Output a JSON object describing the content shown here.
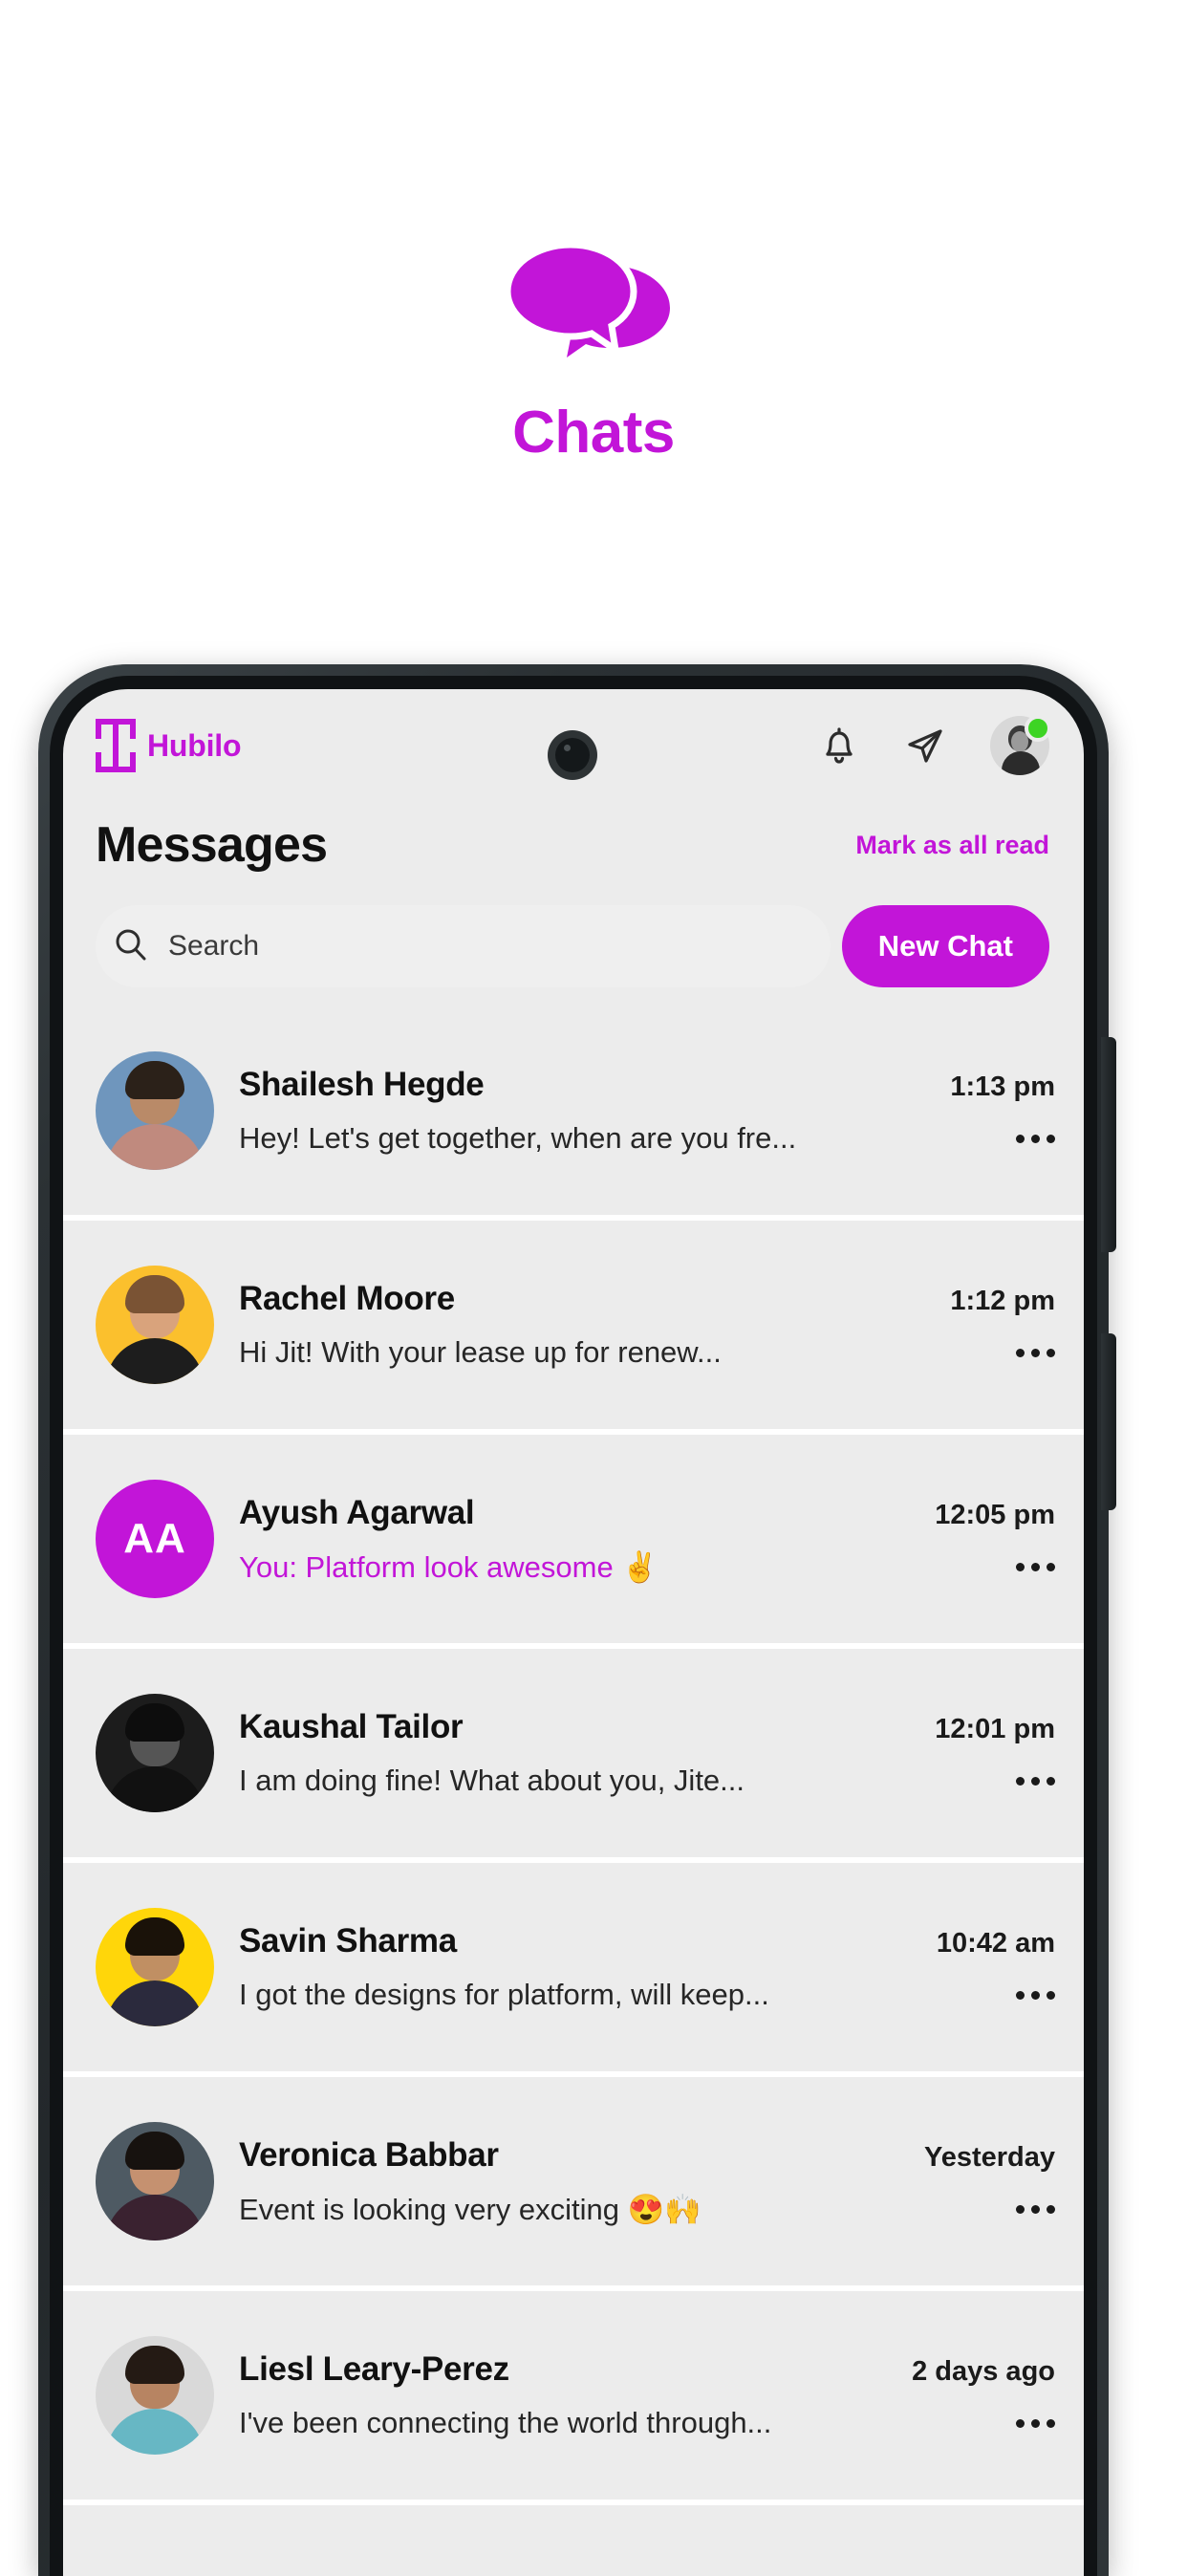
{
  "hero": {
    "title": "Chats",
    "icon": "chat-bubbles-icon",
    "accent_color": "#C215D8"
  },
  "phone": {
    "screen_bg": "#ECECEC",
    "frame_color": "#23282b"
  },
  "appbar": {
    "brand_name": "Hubilo",
    "brand_mark": "hubilo-logo-icon",
    "actions": [
      {
        "name": "notifications-icon",
        "label": "Notifications"
      },
      {
        "name": "send-message-icon",
        "label": "Send"
      },
      {
        "name": "profile-avatar",
        "label": "Profile",
        "status": "online",
        "status_color": "#3DD424"
      }
    ]
  },
  "header": {
    "title": "Messages",
    "mark_all_read": "Mark as all read"
  },
  "search": {
    "placeholder": "Search",
    "value": "",
    "icon": "search-icon"
  },
  "new_chat": {
    "label": "New Chat",
    "color": "#C215D8"
  },
  "chats": [
    {
      "name": "Shailesh Hegde",
      "time": "1:13 pm",
      "preview": "Hey! Let's get together, when are you fre...",
      "own_message": false,
      "avatar_type": "photo",
      "avatar_bg": "#6f96bd",
      "skin": "#b98a68",
      "hair": "#2b2119",
      "shirt": "#c08a7e"
    },
    {
      "name": "Rachel Moore",
      "time": "1:12 pm",
      "preview": "Hi Jit! With your lease up for renew...",
      "own_message": false,
      "avatar_type": "photo",
      "avatar_bg": "#FBC02D",
      "skin": "#d9a37c",
      "hair": "#7a5334",
      "shirt": "#1d1d1d"
    },
    {
      "name": "Ayush Agarwal",
      "time": "12:05 pm",
      "preview": "You: Platform look awesome ✌️",
      "own_message": true,
      "avatar_type": "initials",
      "initials": "AA",
      "avatar_bg": "#C215D8"
    },
    {
      "name": "Kaushal Tailor",
      "time": "12:01 pm",
      "preview": "I am doing fine! What about you, Jite...",
      "own_message": false,
      "avatar_type": "photo",
      "avatar_bg": "#1c1c1c",
      "skin": "#555555",
      "hair": "#0d0d0d",
      "shirt": "#111111"
    },
    {
      "name": "Savin Sharma",
      "time": "10:42 am",
      "preview": "I got the designs for platform, will keep...",
      "own_message": false,
      "avatar_type": "photo",
      "avatar_bg": "#FFD60A",
      "skin": "#c08f63",
      "hair": "#1a1209",
      "shirt": "#2b2a3d"
    },
    {
      "name": "Veronica Babbar",
      "time": "Yesterday",
      "preview": "Event is looking very exciting 😍🙌",
      "own_message": false,
      "avatar_type": "photo",
      "avatar_bg": "#4e5a63",
      "skin": "#c59170",
      "hair": "#17120f",
      "shirt": "#3a2230"
    },
    {
      "name": "Liesl Leary-Perez",
      "time": "2 days ago",
      "preview": "I've been connecting the world through...",
      "own_message": false,
      "avatar_type": "photo",
      "avatar_bg": "#d9d9d9",
      "skin": "#b78462",
      "hair": "#241a14",
      "shirt": "#67b7c4"
    }
  ]
}
